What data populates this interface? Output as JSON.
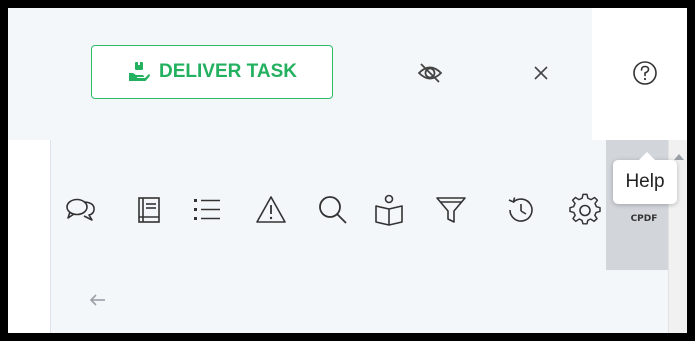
{
  "header": {
    "deliver_task_label": "DELIVER TASK",
    "deliver_icon": "hand-box-icon",
    "hide_icon": "eye-off-icon",
    "close_icon": "close-icon",
    "help_icon": "help-circle-icon"
  },
  "tooltip": {
    "text": "Help"
  },
  "toolbar": {
    "icons": [
      "comments-icon",
      "book-icon",
      "list-icon",
      "warning-icon",
      "search-icon",
      "reader-icon",
      "filter-icon",
      "history-icon",
      "settings-icon"
    ],
    "pdf_label": "CPDF"
  },
  "nav": {
    "back_icon": "arrow-left-icon"
  },
  "colors": {
    "accent": "#23b05f",
    "icon": "#333333",
    "header_bg": "#f4f7fa",
    "scroll_strip": "#d2d6db"
  }
}
